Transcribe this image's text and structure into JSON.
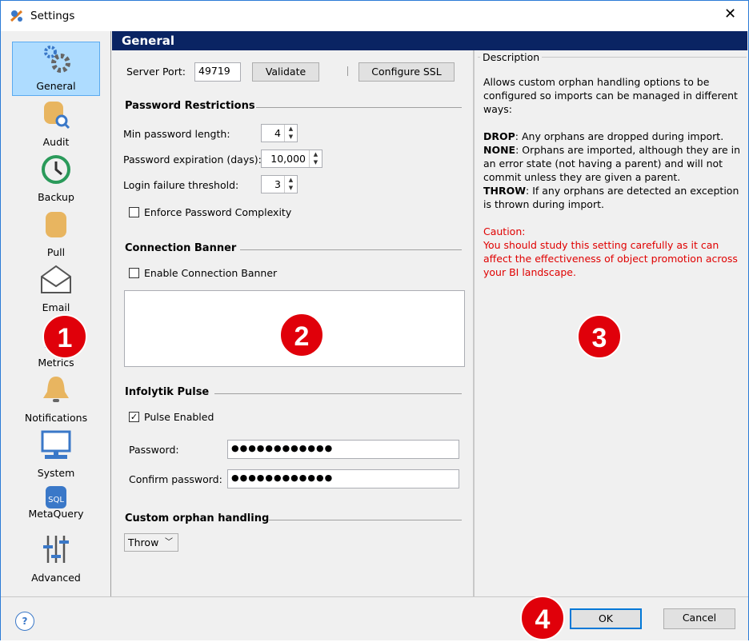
{
  "window": {
    "title": "Settings",
    "close_icon": "close-icon"
  },
  "sidebar": {
    "items": [
      {
        "label": "General",
        "icon": "gears-icon",
        "selected": true
      },
      {
        "label": "Audit",
        "icon": "database-search-icon"
      },
      {
        "label": "Backup",
        "icon": "history-clock-icon"
      },
      {
        "label": "Pull",
        "icon": "database-icon"
      },
      {
        "label": "Email",
        "icon": "envelope-icon"
      },
      {
        "label": "Metrics",
        "icon": "chart-icon"
      },
      {
        "label": "Notifications",
        "icon": "bell-icon"
      },
      {
        "label": "System",
        "icon": "monitor-icon"
      },
      {
        "label": "MetaQuery",
        "icon": "sql-database-icon"
      },
      {
        "label": "Advanced",
        "icon": "sliders-icon"
      }
    ]
  },
  "header": {
    "title": "General"
  },
  "general": {
    "server_port_label": "Server Port:",
    "server_port": "49719",
    "validate": "Validate",
    "configure_ssl": "Configure SSL",
    "password_restrictions": "Password Restrictions",
    "min_length_label": "Min password length:",
    "min_length": "4",
    "expiration_label": "Password expiration (days):",
    "expiration": "10,000",
    "login_failure_label": "Login failure threshold:",
    "login_failure": "3",
    "enforce_complexity": "Enforce Password Complexity",
    "enforce_complexity_checked": false,
    "connection_banner": "Connection Banner",
    "enable_banner": "Enable Connection Banner",
    "enable_banner_checked": false,
    "banner_text": "",
    "pulse": "Infolytik Pulse",
    "pulse_enabled": "Pulse Enabled",
    "pulse_enabled_checked": true,
    "password_label": "Password:",
    "password": "●●●●●●●●●●●●",
    "confirm_label": "Confirm password:",
    "confirm": "●●●●●●●●●●●●",
    "orphan": "Custom orphan handling",
    "orphan_value": "Throw"
  },
  "description": {
    "title": "Description",
    "intro": "Allows custom orphan handling options to be configured so imports can be managed in different ways:",
    "drop_key": "DROP",
    "drop_text": ": Any orphans are dropped during import.",
    "none_key": "NONE",
    "none_text": ": Orphans are imported, although they are in an error state (not having a parent) and will not commit unless they are given a parent.",
    "throw_key": "THROW",
    "throw_text": ": If any orphans are detected an exception is thrown during import.",
    "caution_title": "Caution:",
    "caution_text": "You should study this setting carefully as it can affect the effectiveness of object promotion across your BI landscape."
  },
  "footer": {
    "ok": "OK",
    "cancel": "Cancel",
    "help_icon": "help-icon"
  },
  "badges": [
    "1",
    "2",
    "3",
    "4"
  ],
  "colors": {
    "header": "#0a2463",
    "selected": "#aedcff",
    "caution": "#e00000",
    "badge": "#e0000a"
  }
}
